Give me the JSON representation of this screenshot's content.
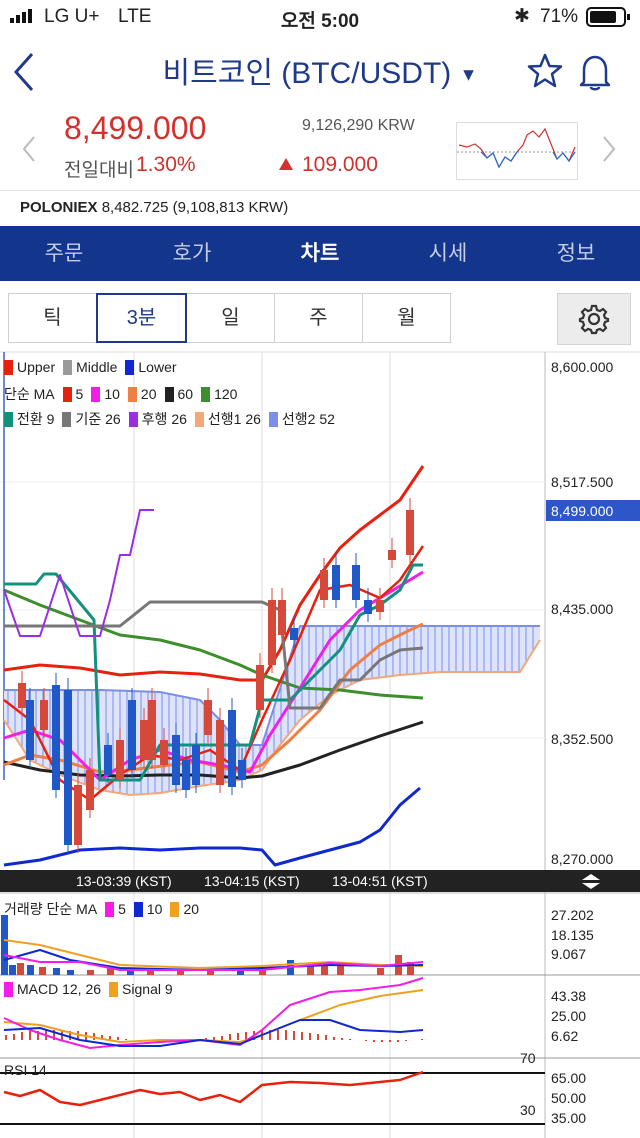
{
  "status_bar": {
    "carrier": "LG U+",
    "network": "LTE",
    "time": "오전 5:00",
    "battery": "71%"
  },
  "header": {
    "title": "비트코인 (BTC/USDT)"
  },
  "quote": {
    "price": "8,499.000",
    "change_label": "전일대비",
    "change_percent": "1.30%",
    "krw": "9,126,290 KRW",
    "change_amount": "109.000"
  },
  "exchange_line": {
    "exchange": "POLONIEX",
    "price": "8,482.725 (9,108,813 KRW)"
  },
  "tabs": [
    {
      "label": "주문"
    },
    {
      "label": "호가"
    },
    {
      "label": "차트",
      "active": true
    },
    {
      "label": "시세"
    },
    {
      "label": "정보"
    }
  ],
  "periods": [
    {
      "label": "틱"
    },
    {
      "label": "3분",
      "selected": true
    },
    {
      "label": "일"
    },
    {
      "label": "주"
    },
    {
      "label": "월"
    }
  ],
  "legends": {
    "bollinger": [
      {
        "label": "Upper",
        "color": "#e8210f"
      },
      {
        "label": "Middle",
        "color": "#9a9a9a"
      },
      {
        "label": "Lower",
        "color": "#1028d0"
      }
    ],
    "ma_title": "단순 MA",
    "ma": [
      {
        "label": "5",
        "color": "#e8210f"
      },
      {
        "label": "10",
        "color": "#f21ee8"
      },
      {
        "label": "20",
        "color": "#f07e45"
      },
      {
        "label": "60",
        "color": "#222222"
      },
      {
        "label": "120",
        "color": "#3c8f2c"
      }
    ],
    "ichimoku": [
      {
        "label": "전환 9",
        "color": "#14917c"
      },
      {
        "label": "기준 26",
        "color": "#777777"
      },
      {
        "label": "후행 26",
        "color": "#9a2ee0"
      },
      {
        "label": "선행1 26",
        "color": "#f3a77a"
      },
      {
        "label": "선행2 52",
        "color": "#7b8ee8"
      }
    ],
    "volume_title": "거래량 단순 MA",
    "volume": [
      {
        "label": "5",
        "color": "#f21ee8"
      },
      {
        "label": "10",
        "color": "#1028d0"
      },
      {
        "label": "20",
        "color": "#f0a020"
      }
    ],
    "macd": [
      {
        "label": "MACD 12, 26",
        "color": "#f21ee8"
      },
      {
        "label": "Signal 9",
        "color": "#f0a020"
      }
    ],
    "rsi": "RSI 14"
  },
  "price_axis": [
    "8,600.000",
    "8,517.500",
    "8,435.000",
    "8,352.500",
    "8,270.000"
  ],
  "current_price_tag": "8,499.000",
  "time_axis": [
    "13-03:39 (KST)",
    "13-04:15 (KST)",
    "13-04:51 (KST)"
  ],
  "volume_axis": [
    "27.202",
    "18.135",
    "9.067"
  ],
  "macd_axis": [
    "43.38",
    "25.00",
    "6.62"
  ],
  "rsi_axis": [
    "65.00",
    "50.00",
    "35.00"
  ],
  "rsi_levels": [
    "70",
    "30"
  ],
  "colors": {
    "brand": "#13358c",
    "up": "#d3312d",
    "down": "#1f54c8"
  }
}
